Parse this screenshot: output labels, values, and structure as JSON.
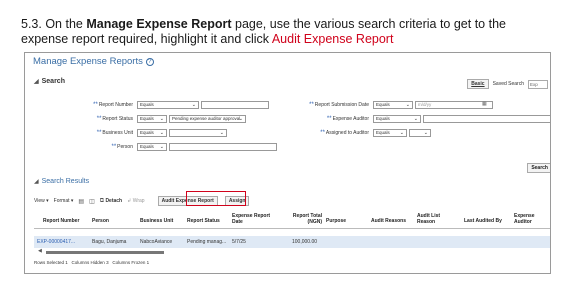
{
  "instruction": {
    "prefix": "5.3. On the ",
    "page_name": "Manage Expense Report",
    "middle": " page, use the various search criteria to get to the expense report required, highlight it and click ",
    "action": "Audit Expense Report"
  },
  "page": {
    "title": "Manage Expense Reports",
    "help_icon": "?"
  },
  "search": {
    "heading": "Search",
    "basic_label": "Basic",
    "saved_search_label": "Saved Search",
    "saved_search_value": "Exp",
    "button": "Search",
    "fields": {
      "report_number": {
        "label": "Report Number",
        "operator": "Equals",
        "value": ""
      },
      "report_status": {
        "label": "Report Status",
        "operator": "Equals",
        "value": "Pending expense auditor approval"
      },
      "business_unit": {
        "label": "Business Unit",
        "operator": "Equals",
        "value": ""
      },
      "person": {
        "label": "Person",
        "operator": "Equals",
        "value": ""
      },
      "submission_date": {
        "label": "Report Submission Date",
        "operator": "Equals",
        "placeholder": "m/d/yy"
      },
      "expense_auditor": {
        "label": "Expense Auditor",
        "operator": "Equals",
        "value": ""
      },
      "assigned_to_auditor": {
        "label": "Assigned to Auditor",
        "operator": "Equals",
        "value": ""
      }
    }
  },
  "results": {
    "heading": "Search Results",
    "toolbar": {
      "view": "View",
      "format": "Format",
      "detach": "Detach",
      "wrap": "Wrap",
      "audit_button": "Audit Expense Report",
      "assign_button": "Assign"
    },
    "columns": {
      "report_number": "Report Number",
      "person": "Person",
      "business_unit": "Business Unit",
      "report_status": "Report Status",
      "expense_report_date": "Expense Report Date",
      "report_total": "Report Total (NGN)",
      "purpose": "Purpose",
      "audit_reasons": "Audit Reasons",
      "audit_list_reason": "Audit List Reason",
      "last_audited_by": "Last Audited By",
      "expense_auditor": "Expense Auditor"
    },
    "row": {
      "report_number": "EXP-00000417...",
      "person": "Bagu, Danjuma",
      "business_unit": "NabcoAviance",
      "report_status": "Pending manag...",
      "expense_report_date": "5/7/25",
      "report_total": "100,000.00"
    },
    "footer": {
      "rows_selected": "Rows Selected  1",
      "columns_hidden": "Columns Hidden  3",
      "columns_frozen": "Columns Frozen  1"
    }
  },
  "colors": {
    "link": "#2a5db0",
    "highlight": "#d0021b",
    "selected_row": "#dfe9f5"
  }
}
